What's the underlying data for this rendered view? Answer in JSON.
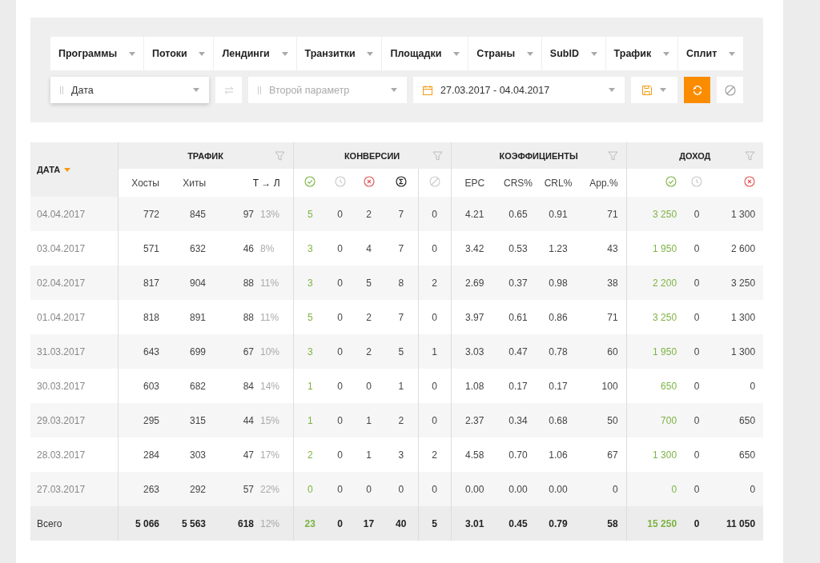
{
  "filters": {
    "tabs": [
      {
        "label": "Программы"
      },
      {
        "label": "Потоки"
      },
      {
        "label": "Лендинги"
      },
      {
        "label": "Транзитки"
      },
      {
        "label": "Площадки"
      },
      {
        "label": "Страны"
      },
      {
        "label": "SubID"
      },
      {
        "label": "Трафик"
      },
      {
        "label": "Сплит"
      }
    ],
    "group_by": {
      "value": "Дата"
    },
    "second_param": {
      "placeholder": "Второй параметр"
    },
    "date_range": {
      "value": "27.03.2017 - 04.04.2017"
    }
  },
  "table": {
    "date_header": {
      "label": "ДАТА",
      "sorted": true
    },
    "groups": [
      {
        "label": "ТРАФИК"
      },
      {
        "label": "КОНВЕРСИИ"
      },
      {
        "label": "КОЭФФИЦИЕНТЫ"
      },
      {
        "label": "ДОХОД"
      }
    ],
    "traffic_columns": [
      "Хосты",
      "Хиты",
      "Т → Л"
    ],
    "coefficient_columns": [
      "EPC",
      "CRS%",
      "CRL%",
      "App.%"
    ],
    "rows": [
      {
        "date": "04.04.2017",
        "hosts": "772",
        "hits": "845",
        "tl": "97",
        "tl_pct": "13%",
        "conversions": [
          "5",
          "0",
          "2",
          "7",
          "0"
        ],
        "coefficients": [
          "4.21",
          "0.65",
          "0.91",
          "71"
        ],
        "income": [
          "3 250",
          "0",
          "1 300"
        ]
      },
      {
        "date": "03.04.2017",
        "hosts": "571",
        "hits": "632",
        "tl": "46",
        "tl_pct": "8%",
        "conversions": [
          "3",
          "0",
          "4",
          "7",
          "0"
        ],
        "coefficients": [
          "3.42",
          "0.53",
          "1.23",
          "43"
        ],
        "income": [
          "1 950",
          "0",
          "2 600"
        ]
      },
      {
        "date": "02.04.2017",
        "hosts": "817",
        "hits": "904",
        "tl": "88",
        "tl_pct": "11%",
        "conversions": [
          "3",
          "0",
          "5",
          "8",
          "2"
        ],
        "coefficients": [
          "2.69",
          "0.37",
          "0.98",
          "38"
        ],
        "income": [
          "2 200",
          "0",
          "3 250"
        ]
      },
      {
        "date": "01.04.2017",
        "hosts": "818",
        "hits": "891",
        "tl": "88",
        "tl_pct": "11%",
        "conversions": [
          "5",
          "0",
          "2",
          "7",
          "0"
        ],
        "coefficients": [
          "3.97",
          "0.61",
          "0.86",
          "71"
        ],
        "income": [
          "3 250",
          "0",
          "1 300"
        ]
      },
      {
        "date": "31.03.2017",
        "hosts": "643",
        "hits": "699",
        "tl": "67",
        "tl_pct": "10%",
        "conversions": [
          "3",
          "0",
          "2",
          "5",
          "1"
        ],
        "coefficients": [
          "3.03",
          "0.47",
          "0.78",
          "60"
        ],
        "income": [
          "1 950",
          "0",
          "1 300"
        ]
      },
      {
        "date": "30.03.2017",
        "hosts": "603",
        "hits": "682",
        "tl": "84",
        "tl_pct": "14%",
        "conversions": [
          "1",
          "0",
          "0",
          "1",
          "0"
        ],
        "coefficients": [
          "1.08",
          "0.17",
          "0.17",
          "100"
        ],
        "income": [
          "650",
          "0",
          "0"
        ]
      },
      {
        "date": "29.03.2017",
        "hosts": "295",
        "hits": "315",
        "tl": "44",
        "tl_pct": "15%",
        "conversions": [
          "1",
          "0",
          "1",
          "2",
          "0"
        ],
        "coefficients": [
          "2.37",
          "0.34",
          "0.68",
          "50"
        ],
        "income": [
          "700",
          "0",
          "650"
        ]
      },
      {
        "date": "28.03.2017",
        "hosts": "284",
        "hits": "303",
        "tl": "47",
        "tl_pct": "17%",
        "conversions": [
          "2",
          "0",
          "1",
          "3",
          "2"
        ],
        "coefficients": [
          "4.58",
          "0.70",
          "1.06",
          "67"
        ],
        "income": [
          "1 300",
          "0",
          "650"
        ]
      },
      {
        "date": "27.03.2017",
        "hosts": "263",
        "hits": "292",
        "tl": "57",
        "tl_pct": "22%",
        "conversions": [
          "0",
          "0",
          "0",
          "0",
          "0"
        ],
        "coefficients": [
          "0.00",
          "0.00",
          "0.00",
          "0"
        ],
        "income": [
          "0",
          "0",
          "0"
        ]
      }
    ],
    "total": {
      "label": "Всего",
      "hosts": "5 066",
      "hits": "5 563",
      "tl": "618",
      "tl_pct": "12%",
      "conversions": [
        "23",
        "0",
        "17",
        "40",
        "5"
      ],
      "coefficients": [
        "3.01",
        "0.45",
        "0.79",
        "58"
      ],
      "income": [
        "15 250",
        "0",
        "11 050"
      ]
    }
  }
}
